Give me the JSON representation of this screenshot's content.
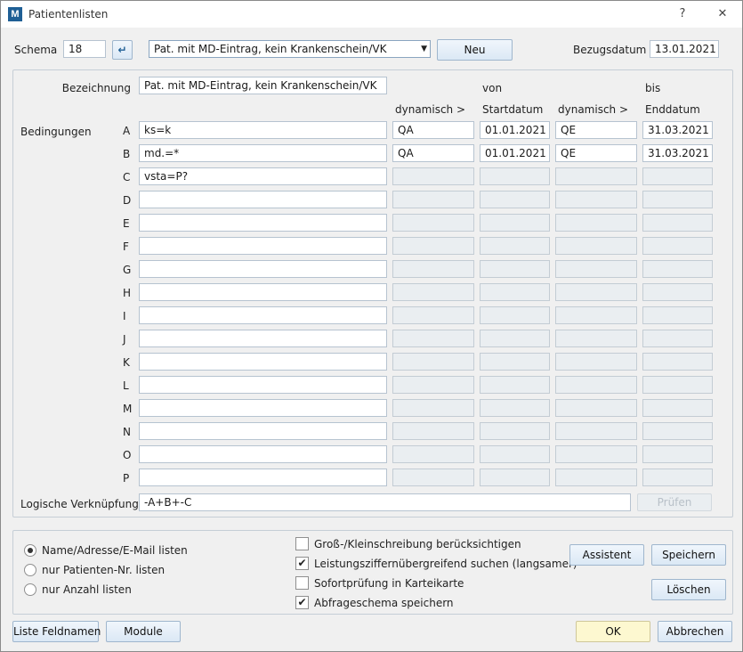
{
  "window": {
    "title": "Patientenlisten",
    "help_glyph": "?",
    "close_glyph": "✕",
    "logo_text": "M"
  },
  "top": {
    "schema_label": "Schema",
    "schema_value": "18",
    "enter_glyph": "↵",
    "dropdown_value": "Pat. mit MD-Eintrag, kein Krankenschein/VK",
    "dropdown_arrow": "▼",
    "new_label": "Neu",
    "bezugsdatum_label": "Bezugsdatum",
    "bezugsdatum_value": "13.01.2021"
  },
  "conditions": {
    "bezeichnung_label": "Bezeichnung",
    "bezeichnung_value": "Pat. mit MD-Eintrag, kein Krankenschein/VK",
    "von_label": "von",
    "bis_label": "bis",
    "dyn1_header": "dynamisch >",
    "startdatum_header": "Startdatum",
    "dyn2_header": "dynamisch >",
    "enddatum_header": "Enddatum",
    "bedingungen_label": "Bedingungen",
    "rows": [
      {
        "letter": "A",
        "expr": "ks=k",
        "dyn1": "QA",
        "start": "01.01.2021",
        "dyn2": "QE",
        "end": "31.03.2021"
      },
      {
        "letter": "B",
        "expr": "md.=*",
        "dyn1": "QA",
        "start": "01.01.2021",
        "dyn2": "QE",
        "end": "31.03.2021"
      },
      {
        "letter": "C",
        "expr": "vsta=P?",
        "dyn1": "",
        "start": "",
        "dyn2": "",
        "end": ""
      },
      {
        "letter": "D",
        "expr": "",
        "dyn1": "",
        "start": "",
        "dyn2": "",
        "end": ""
      },
      {
        "letter": "E",
        "expr": "",
        "dyn1": "",
        "start": "",
        "dyn2": "",
        "end": ""
      },
      {
        "letter": "F",
        "expr": "",
        "dyn1": "",
        "start": "",
        "dyn2": "",
        "end": ""
      },
      {
        "letter": "G",
        "expr": "",
        "dyn1": "",
        "start": "",
        "dyn2": "",
        "end": ""
      },
      {
        "letter": "H",
        "expr": "",
        "dyn1": "",
        "start": "",
        "dyn2": "",
        "end": ""
      },
      {
        "letter": "I",
        "expr": "",
        "dyn1": "",
        "start": "",
        "dyn2": "",
        "end": ""
      },
      {
        "letter": "J",
        "expr": "",
        "dyn1": "",
        "start": "",
        "dyn2": "",
        "end": ""
      },
      {
        "letter": "K",
        "expr": "",
        "dyn1": "",
        "start": "",
        "dyn2": "",
        "end": ""
      },
      {
        "letter": "L",
        "expr": "",
        "dyn1": "",
        "start": "",
        "dyn2": "",
        "end": ""
      },
      {
        "letter": "M",
        "expr": "",
        "dyn1": "",
        "start": "",
        "dyn2": "",
        "end": ""
      },
      {
        "letter": "N",
        "expr": "",
        "dyn1": "",
        "start": "",
        "dyn2": "",
        "end": ""
      },
      {
        "letter": "O",
        "expr": "",
        "dyn1": "",
        "start": "",
        "dyn2": "",
        "end": ""
      },
      {
        "letter": "P",
        "expr": "",
        "dyn1": "",
        "start": "",
        "dyn2": "",
        "end": ""
      }
    ],
    "logic_label": "Logische Verknüpfung",
    "logic_value": "-A+B+-C",
    "pruefen_label": "Prüfen"
  },
  "options": {
    "radios": [
      {
        "label": "Name/Adresse/E-Mail listen",
        "selected": true
      },
      {
        "label": "nur Patienten-Nr. listen",
        "selected": false
      },
      {
        "label": "nur Anzahl listen",
        "selected": false
      }
    ],
    "checkboxes": [
      {
        "label": "Groß-/Kleinschreibung berücksichtigen",
        "checked": false
      },
      {
        "label": "Leistungsziffernübergreifend suchen (langsamer)",
        "checked": true
      },
      {
        "label": "Sofortprüfung in Karteikarte",
        "checked": false
      },
      {
        "label": "Abfrageschema speichern",
        "checked": true
      }
    ],
    "assistent_label": "Assistent",
    "speichern_label": "Speichern",
    "loeschen_label": "Löschen"
  },
  "footer": {
    "feldnamen_label": "Liste Feldnamen",
    "module_label": "Module",
    "ok_label": "OK",
    "abbrechen_label": "Abbrechen"
  },
  "colors": {
    "accent": "#1f5f95",
    "ok_background": "#fdf8d0",
    "disabled_field": "#eaeef1",
    "panel_border": "#c5ced6"
  }
}
